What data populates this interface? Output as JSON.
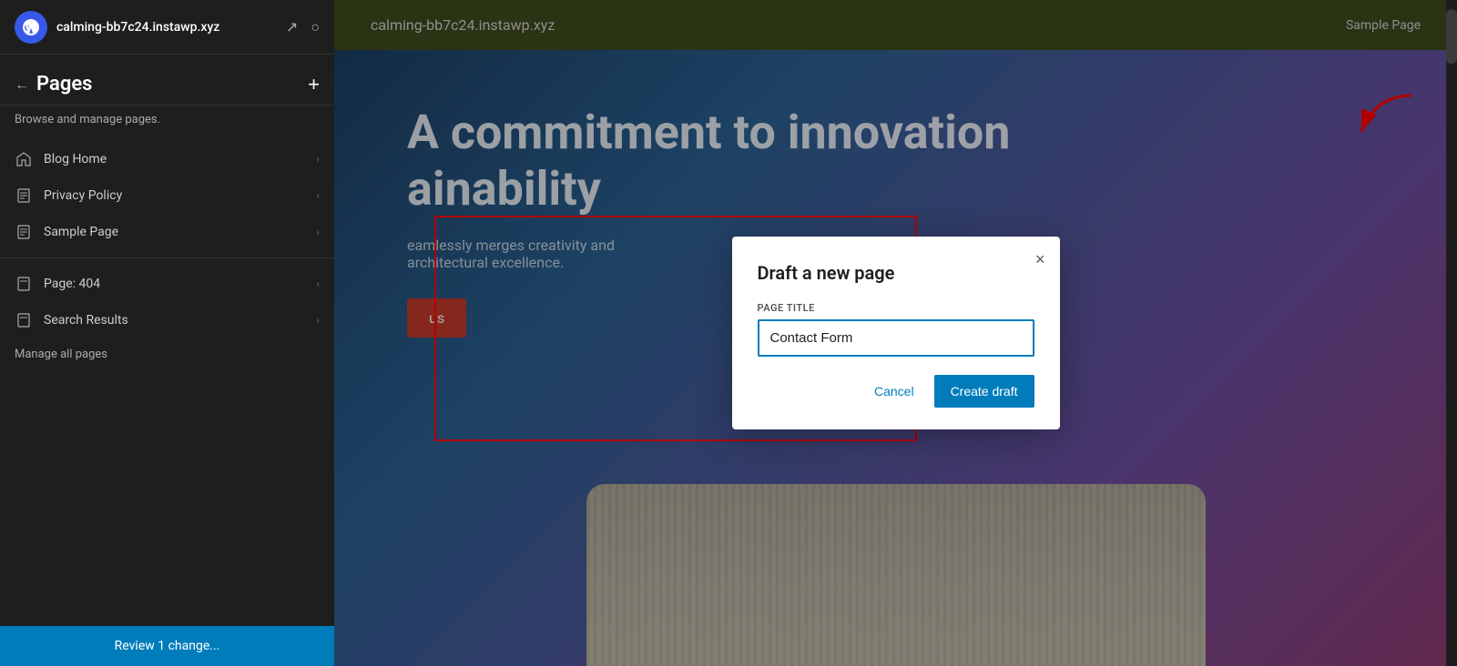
{
  "sidebar": {
    "site_title": "calming-bb7c24.instawp.xyz",
    "panel_title": "Pages",
    "subtitle": "Browse and manage pages.",
    "add_button_label": "+",
    "nav_items": [
      {
        "id": "blog-home",
        "label": "Blog Home",
        "icon": "home"
      },
      {
        "id": "privacy-policy",
        "label": "Privacy Policy",
        "icon": "document"
      },
      {
        "id": "sample-page",
        "label": "Sample Page",
        "icon": "document"
      }
    ],
    "extra_items": [
      {
        "id": "page-404",
        "label": "Page: 404",
        "icon": "page"
      },
      {
        "id": "search-results",
        "label": "Search Results",
        "icon": "page"
      }
    ],
    "manage_all": "Manage all pages",
    "review_bar": "Review 1 change..."
  },
  "preview": {
    "site_name": "calming-bb7c24.instawp.xyz",
    "nav_link": "Sample Page",
    "headline_line1": "A commitment to innovation",
    "headline_line2": "ainability",
    "subtext_line1": "eamlessly merges creativity and",
    "subtext_line2": "architectural excellence."
  },
  "modal": {
    "title": "Draft a new page",
    "page_title_label": "PAGE TITLE",
    "page_title_value": "Contact Form",
    "page_title_placeholder": "Contact Form",
    "cancel_label": "Cancel",
    "create_label": "Create draft",
    "close_icon": "×"
  }
}
